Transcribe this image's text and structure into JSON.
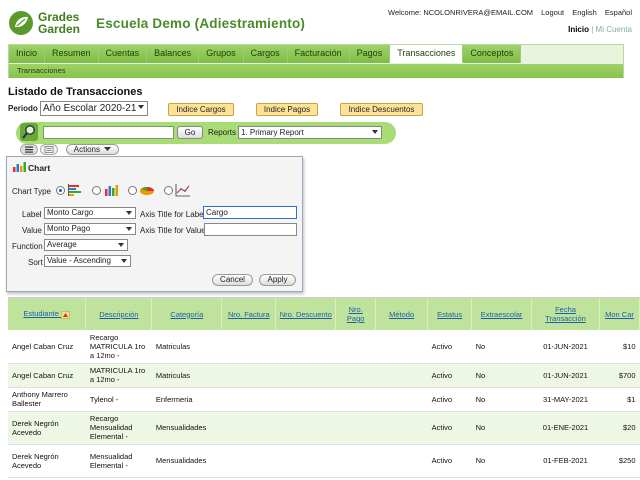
{
  "header": {
    "logo_line1": "Grades",
    "logo_line2": "Garden",
    "school_title": "Escuela Demo (Adiestramiento)",
    "welcome": "Welcome: NCOLONRIVERA@EMAIL.COM",
    "logout": "Logout",
    "english": "English",
    "espanol": "Español",
    "mode_selected": "Inicio",
    "mode_separator": "|",
    "mode_other": "Mi Cuenta"
  },
  "nav": {
    "tabs": [
      "Inicio",
      "Resumen",
      "Cuentas",
      "Balances",
      "Grupos",
      "Cargos",
      "Facturación",
      "Pagos",
      "Transacciones",
      "Conceptos"
    ],
    "active": "Transacciones",
    "subnav": "Transacciones"
  },
  "page": {
    "title": "Listado de Transacciones",
    "periodo_label": "Periodo",
    "periodo_value": "Año Escolar 2020-21",
    "btn_cargos": "Indice Cargos",
    "btn_pagos": "Indice Pagos",
    "btn_descuentos": "Indice Descuentos"
  },
  "search": {
    "go": "Go",
    "reports_label": "Reports",
    "reports_value": "1. Primary Report",
    "actions": "Actions"
  },
  "chart_panel": {
    "title": "Chart",
    "chart_type_label": "Chart Type",
    "label_label": "Label",
    "label_value": "Monto Cargo",
    "axis_title_label": "Axis Title for Label",
    "axis_title_label_value": "Cargo",
    "value_label": "Value",
    "value_value": "Monto Pago",
    "axis_title_value": "Axis Title for Value",
    "axis_title_value_value": "",
    "function_label": "Function",
    "function_value": "Average",
    "sort_label": "Sort",
    "sort_value": "Value - Ascending",
    "cancel": "Cancel",
    "apply": "Apply"
  },
  "table": {
    "headers": [
      "Estudiante",
      "Descripción",
      "Categoría",
      "Nro. Factura",
      "Nro. Descuento",
      "Nro. Pago",
      "Método",
      "Estatus",
      "Extraescolar",
      "Fecha Transacción",
      "Mon Car"
    ],
    "rows": [
      [
        "Angel Caban Cruz",
        "Recargo MATRICULA 1ro a 12mo -",
        "Matriculas",
        "",
        "",
        "",
        "",
        "Activo",
        "No",
        "01-JUN-2021",
        "$10"
      ],
      [
        "Angel Caban Cruz",
        "MATRICULA 1ro a 12mo -",
        "Matriculas",
        "",
        "",
        "",
        "",
        "Activo",
        "No",
        "01-JUN-2021",
        "$700"
      ],
      [
        "Anthony Marrero Ballester",
        "Tylenol -",
        "Enfermeria",
        "",
        "",
        "",
        "",
        "Activo",
        "No",
        "31-MAY-2021",
        "$1"
      ],
      [
        "Derek Negrón Acevedo",
        "Recargo Mensualidad Elemental -",
        "Mensualidades",
        "",
        "",
        "",
        "",
        "Activo",
        "No",
        "01-ENE-2021",
        "$20"
      ],
      [
        "Derek Negrón Acevedo",
        "Mensualidad Elemental -",
        "Mensualidades",
        "",
        "",
        "",
        "",
        "Activo",
        "No",
        "01-FEB-2021",
        "$250"
      ]
    ]
  },
  "colors": {
    "brand_green": "#4a8a2a",
    "tab_green": "#8cc655",
    "header_green": "#bfe39c",
    "link_blue": "#1f5ea8"
  }
}
